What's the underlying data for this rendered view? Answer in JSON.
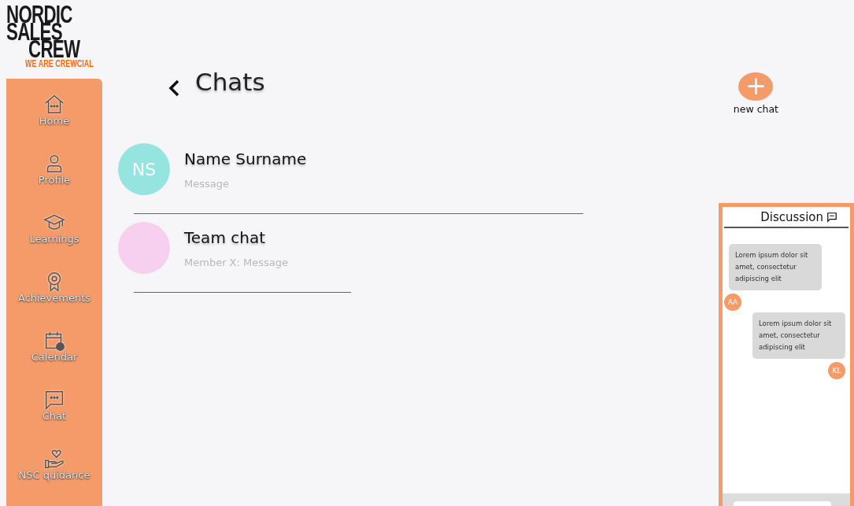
{
  "logo": {
    "lines": [
      "NORDIC",
      "SALES",
      "CREW"
    ],
    "tagline": "WE ARE CREWCIAL"
  },
  "sidebar": {
    "items": [
      {
        "label": "Home",
        "kind": "home"
      },
      {
        "label": "Profile",
        "kind": "profile"
      },
      {
        "label": "Learnings",
        "kind": "cap"
      },
      {
        "label": "Achievements",
        "kind": "medal"
      },
      {
        "label": "Calendar",
        "kind": "calendar"
      },
      {
        "label": "Chat",
        "kind": "chat"
      },
      {
        "label": "NSC quidance",
        "kind": "hand"
      }
    ]
  },
  "header": {
    "title": "Chats",
    "new_chat": {
      "icon": "+",
      "label": "new chat"
    }
  },
  "chats": [
    {
      "name": "Name Surname",
      "initials": "NS",
      "message": "Message",
      "color": "#96e4e0"
    },
    {
      "name": "Team chat",
      "message": "Member X: Message",
      "color": "#f6d0ee"
    }
  ],
  "discussion": {
    "title": "Discussion",
    "messages": [
      {
        "text": "Lorem ipsum dolor sit amet, consectetur adipiscing elit",
        "author": "AA",
        "kind": "left"
      },
      {
        "text": "Lorem ipsum dolor sit amet, consectetur adipiscing elit",
        "author": "KL",
        "kind": "right"
      }
    ]
  }
}
